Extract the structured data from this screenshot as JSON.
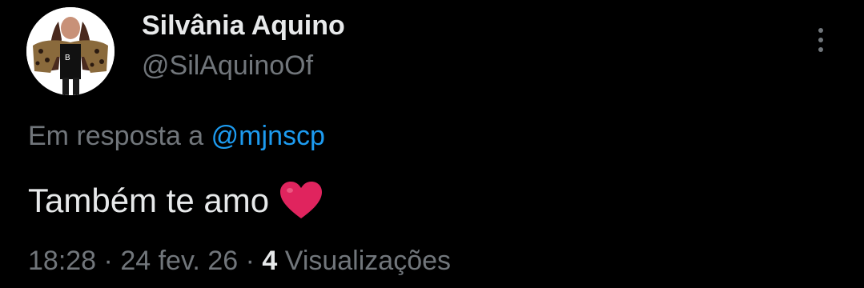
{
  "author": {
    "display_name": "Silvânia Aquino",
    "handle": "@SilAquinoOf"
  },
  "reply": {
    "prefix": "Em resposta a",
    "mention": "@mjnscp"
  },
  "tweet": {
    "text": "Também te amo",
    "emoji_icon": "red-heart-icon"
  },
  "meta": {
    "time": "18:28",
    "separator": "·",
    "date": "24 fev. 26",
    "views_count": "4",
    "views_label": "Visualizações"
  },
  "colors": {
    "background": "#000000",
    "primary_text": "#e7e9ea",
    "secondary_text": "#71767b",
    "link": "#1d9bf0",
    "heart": "#e0245e"
  }
}
